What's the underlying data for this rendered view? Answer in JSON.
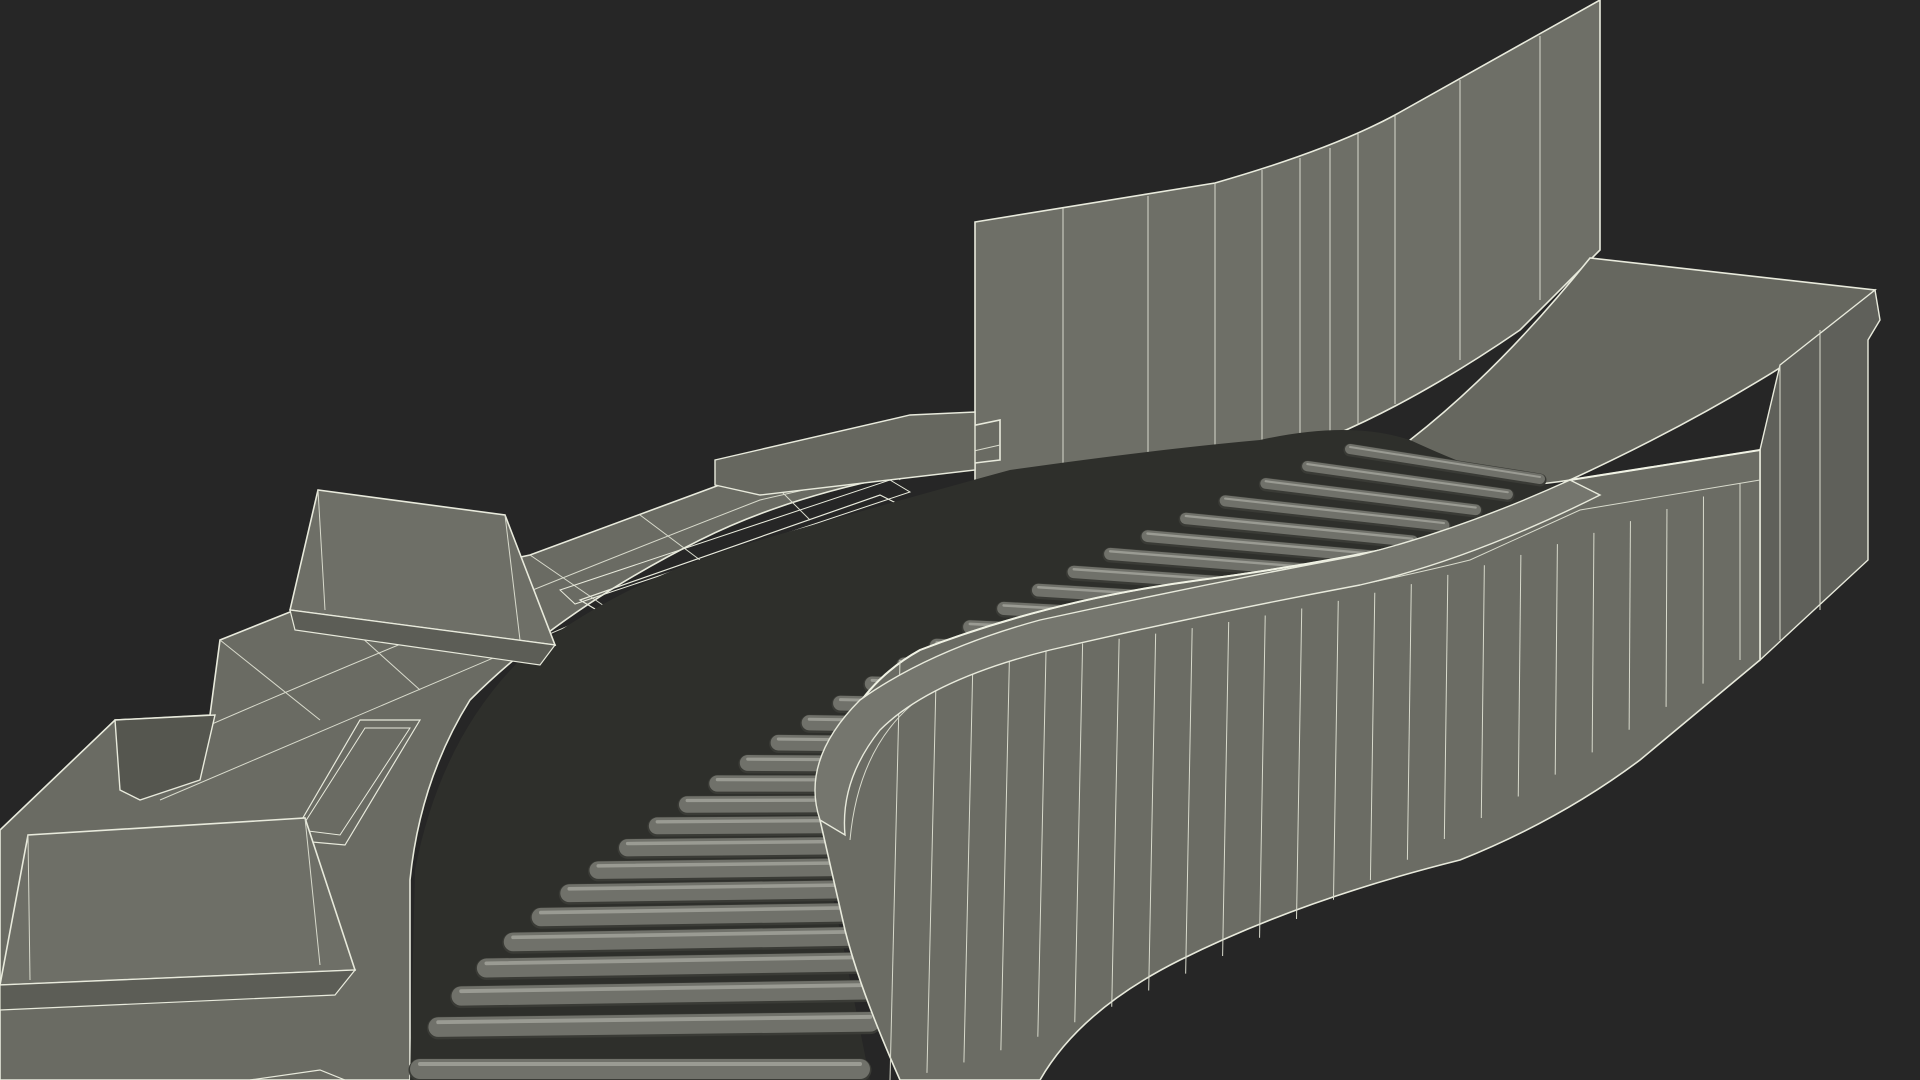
{
  "render": {
    "background_color": "#262626",
    "surface_color": "#6c6d64",
    "surface_light_color": "#7a7b72",
    "surface_dark_color": "#54554d",
    "wire_color": "#e8eadc",
    "roller_color": "#70716a",
    "roller_highlight_color": "#9a9b93",
    "roller_shadow_color": "#3a3b36",
    "roller_count": 30
  }
}
